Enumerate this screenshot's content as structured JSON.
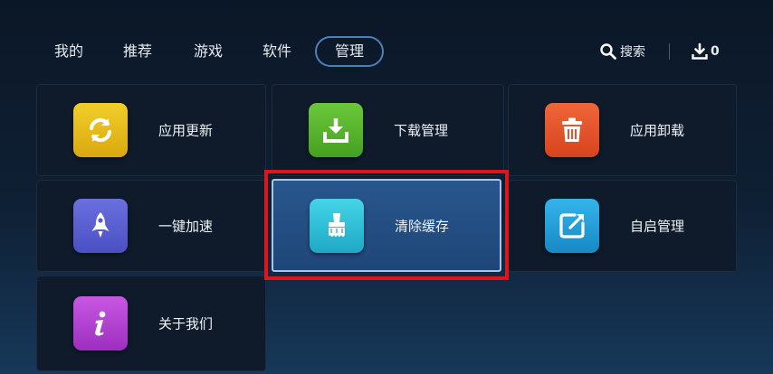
{
  "nav": {
    "tabs": [
      {
        "label": "我的"
      },
      {
        "label": "推荐"
      },
      {
        "label": "游戏"
      },
      {
        "label": "软件"
      },
      {
        "label": "管理",
        "active": true
      }
    ],
    "search_label": "搜索",
    "download_count": "0"
  },
  "tiles": [
    {
      "label": "应用更新",
      "icon": "refresh-icon",
      "color": "#e4b81a"
    },
    {
      "label": "下载管理",
      "icon": "download-tray-icon",
      "color": "#58b22c"
    },
    {
      "label": "应用卸载",
      "icon": "trash-icon",
      "color": "#e5532a"
    },
    {
      "label": "一键加速",
      "icon": "rocket-icon",
      "color": "#5a5fd0"
    },
    {
      "label": "清除缓存",
      "icon": "brush-icon",
      "color": "#2ec0d8",
      "selected": true
    },
    {
      "label": "自启管理",
      "icon": "edit-square-icon",
      "color": "#1f9fd8"
    },
    {
      "label": "关于我们",
      "icon": "info-icon",
      "color": "#b43fd2"
    }
  ],
  "colors": {
    "background": "#0f2034",
    "selection_frame": "#e0151b",
    "active_tab_border": "#4f7fb9"
  }
}
